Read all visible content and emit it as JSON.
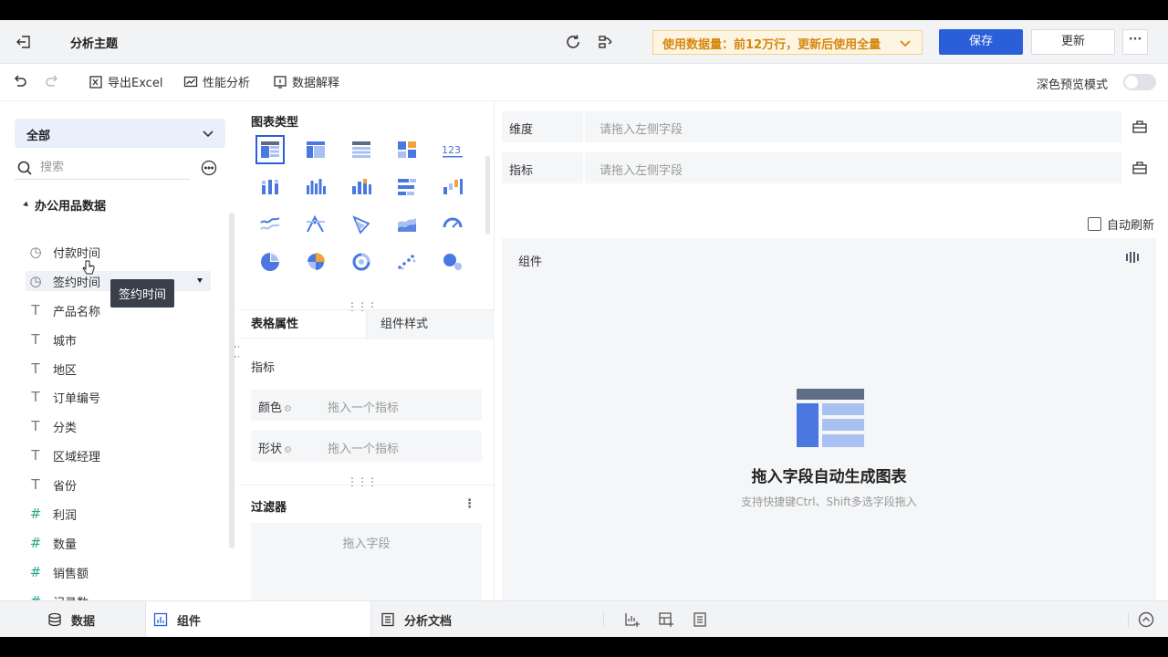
{
  "header": {
    "title": "分析主题",
    "notice": "使用数据量：前12万行，更新后使用全量",
    "save_label": "保存",
    "update_label": "更新",
    "more_label": "···"
  },
  "toolbar": {
    "export_label": "导出Excel",
    "perf_label": "性能分析",
    "explain_label": "数据解释",
    "dark_mode_label": "深色预览模式"
  },
  "left": {
    "selector": "全部",
    "search_placeholder": "搜索",
    "group": "办公用品数据",
    "fields": [
      {
        "icon": "◷",
        "label": "付款时间"
      },
      {
        "icon": "◷",
        "label": "签约时间"
      },
      {
        "icon": "T",
        "label": "产品名称"
      },
      {
        "icon": "T",
        "label": "城市"
      },
      {
        "icon": "T",
        "label": "地区"
      },
      {
        "icon": "T",
        "label": "订单编号"
      },
      {
        "icon": "T",
        "label": "分类"
      },
      {
        "icon": "T",
        "label": "区域经理"
      },
      {
        "icon": "T",
        "label": "省份"
      },
      {
        "icon": "#",
        "label": "利润"
      },
      {
        "icon": "#",
        "label": "数量"
      },
      {
        "icon": "#",
        "label": "销售额"
      },
      {
        "icon": "#",
        "label": "记录数"
      }
    ],
    "tooltip": "签约时间"
  },
  "mid": {
    "chart_types_title": "图表类型",
    "tab_table": "表格属性",
    "tab_style": "组件样式",
    "indicator_label": "指标",
    "color_label": "颜色",
    "color_placeholder": "拖入一个指标",
    "shape_label": "形状",
    "shape_placeholder": "拖入一个指标",
    "filter_title": "过滤器",
    "filter_placeholder": "拖入字段"
  },
  "right": {
    "dim_label": "维度",
    "dim_placeholder": "请拖入左侧字段",
    "metric_label": "指标",
    "metric_placeholder": "请拖入左侧字段",
    "auto_refresh": "自动刷新",
    "canvas_label": "组件",
    "empty_title": "拖入字段自动生成图表",
    "empty_sub": "支持快捷键Ctrl、Shift多选字段拖入"
  },
  "bottom": {
    "data_tab": "数据",
    "component_tab": "组件",
    "doc_tab": "分析文档"
  },
  "colors": {
    "primary": "#2b5ed9",
    "chart_blue": "#4a78e0",
    "chart_light": "#a9c1f2",
    "chart_orange": "#f0a23c",
    "notice_text": "#d4880f"
  }
}
